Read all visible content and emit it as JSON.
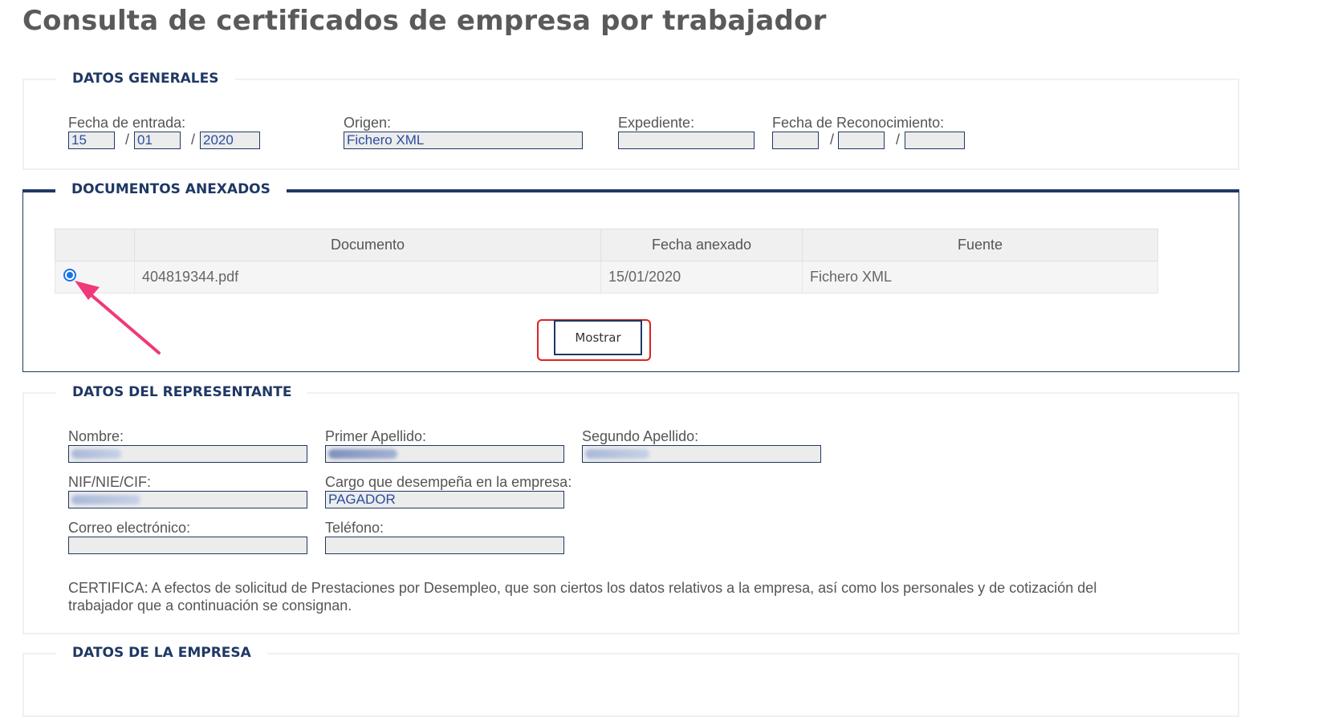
{
  "page_title": "Consulta de certificados de empresa por trabajador",
  "datos_generales": {
    "legend": "DATOS GENERALES",
    "fecha_entrada_label": "Fecha de entrada:",
    "fecha_entrada_dia": "15",
    "fecha_entrada_mes": "01",
    "fecha_entrada_anio": "2020",
    "date_separator": "/",
    "origen_label": "Origen:",
    "origen_value": "Fichero XML",
    "expediente_label": "Expediente:",
    "expediente_value": "",
    "fecha_reconocimiento_label": "Fecha de Reconocimiento:"
  },
  "documentos_anexados": {
    "legend": "DOCUMENTOS ANEXADOS",
    "columns": [
      "",
      "Documento",
      "Fecha anexado",
      "Fuente"
    ],
    "rows": [
      {
        "selected": true,
        "documento": "404819344.pdf",
        "fecha": "15/01/2020",
        "fuente": "Fichero XML"
      }
    ],
    "mostrar_label": "Mostrar",
    "annotation_arrow_color": "#f0397a",
    "highlight_color": "#e02020"
  },
  "datos_representante": {
    "legend": "DATOS DEL REPRESENTANTE",
    "nombre_label": "Nombre:",
    "primer_apellido_label": "Primer Apellido:",
    "segundo_apellido_label": "Segundo Apellido:",
    "nif_label": "NIF/NIE/CIF:",
    "cargo_label": "Cargo que desempeña en la empresa:",
    "cargo_value": "PAGADOR",
    "correo_label": "Correo electrónico:",
    "telefono_label": "Teléfono:",
    "certifica_text": "CERTIFICA: A efectos de solicitud de Prestaciones por Desempleo, que son ciertos los datos relativos a la empresa, así como los personales y de cotización del trabajador que a continuación se consignan."
  },
  "datos_empresa": {
    "legend": "DATOS DE LA EMPRESA"
  },
  "colors": {
    "accent": "#1f3864",
    "input_text": "#2a4ea0",
    "input_bg": "#ececec"
  }
}
